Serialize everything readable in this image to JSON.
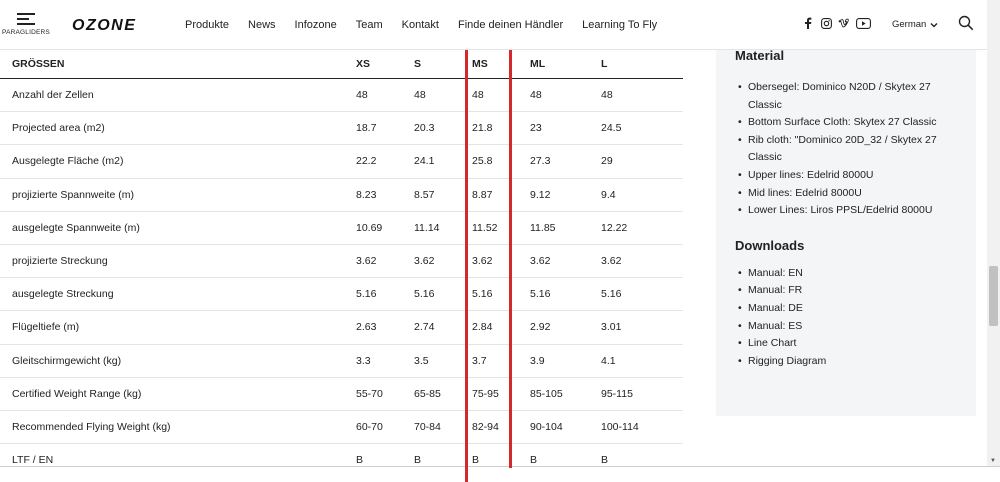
{
  "header": {
    "menu_label": "PARAGLIDERS",
    "logo_text": "OZONE",
    "nav": [
      "Produkte",
      "News",
      "Infozone",
      "Team",
      "Kontakt",
      "Finde deinen Händler",
      "Learning To Fly"
    ],
    "social_icons": [
      "facebook-icon",
      "instagram-icon",
      "vimeo-icon",
      "youtube-icon"
    ],
    "language": "German"
  },
  "specs": {
    "header": [
      "GRÖSSEN",
      "XS",
      "S",
      "MS",
      "ML",
      "L"
    ],
    "rows": [
      [
        "Anzahl der Zellen",
        "48",
        "48",
        "48",
        "48",
        "48"
      ],
      [
        "Projected area (m2)",
        "18.7",
        "20.3",
        "21.8",
        "23",
        "24.5"
      ],
      [
        "Ausgelegte Fläche (m2)",
        "22.2",
        "24.1",
        "25.8",
        "27.3",
        "29"
      ],
      [
        "projizierte Spannweite (m)",
        "8.23",
        "8.57",
        "8.87",
        "9.12",
        "9.4"
      ],
      [
        "ausgelegte Spannweite (m)",
        "10.69",
        "11.14",
        "11.52",
        "11.85",
        "12.22"
      ],
      [
        "projizierte Streckung",
        "3.62",
        "3.62",
        "3.62",
        "3.62",
        "3.62"
      ],
      [
        "ausgelegte Streckung",
        "5.16",
        "5.16",
        "5.16",
        "5.16",
        "5.16"
      ],
      [
        "Flügeltiefe (m)",
        "2.63",
        "2.74",
        "2.84",
        "2.92",
        "3.01"
      ],
      [
        "Gleitschirmgewicht (kg)",
        "3.3",
        "3.5",
        "3.7",
        "3.9",
        "4.1"
      ],
      [
        "Certified Weight Range (kg)",
        "55-70",
        "65-85",
        "75-95",
        "85-105",
        "95-115"
      ],
      [
        "Recommended Flying Weight (kg)",
        "60-70",
        "70-84",
        "82-94",
        "90-104",
        "100-114"
      ],
      [
        "LTF / EN",
        "B",
        "B",
        "B",
        "B",
        "B"
      ]
    ]
  },
  "panel": {
    "material_title": "Material",
    "material": [
      "Obersegel: Dominico N20D / Skytex 27 Classic",
      "Bottom Surface Cloth: Skytex 27 Classic",
      "Rib cloth: \"Dominico 20D_32 / Skytex 27 Classic",
      "Upper lines: Edelrid 8000U",
      "Mid lines: Edelrid 8000U",
      "Lower Lines: Liros PPSL/Edelrid 8000U"
    ],
    "downloads_title": "Downloads",
    "downloads": [
      "Manual: EN",
      "Manual: FR",
      "Manual: DE",
      "Manual: ES",
      "Line Chart",
      "Rigging Diagram"
    ]
  },
  "colors": {
    "highlight": "#d4282c",
    "panel_bg": "#f4f5f7"
  }
}
